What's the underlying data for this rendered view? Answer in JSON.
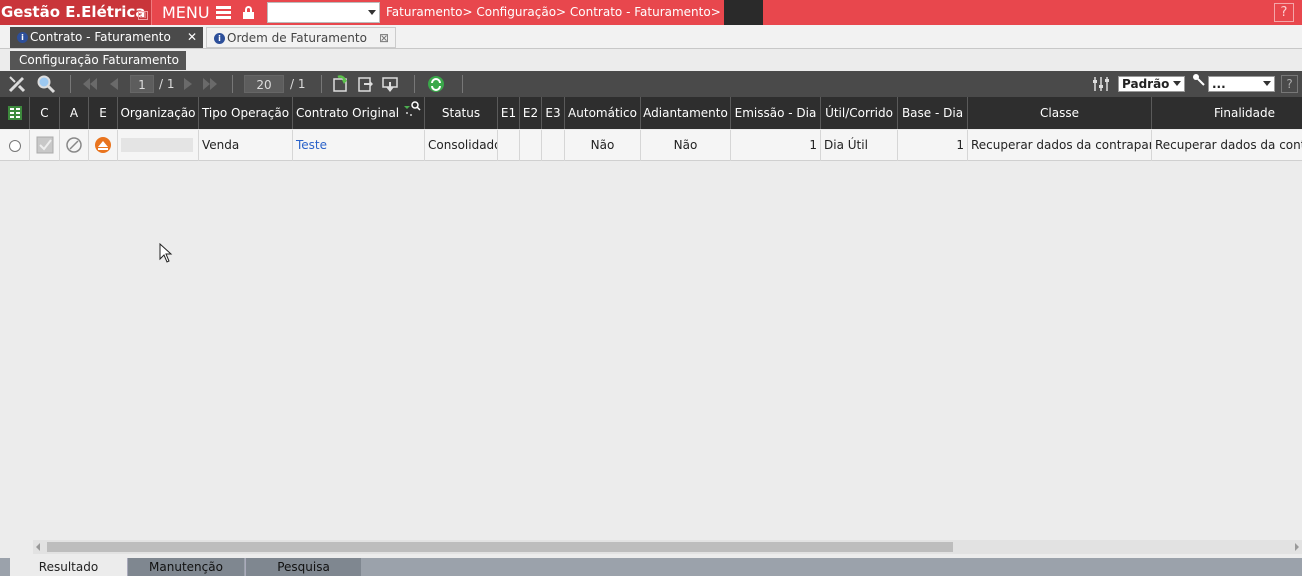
{
  "header": {
    "brand": "Gestão E.Elétrica",
    "brand_badge": "□",
    "menu_label": "MENU",
    "breadcrumb": "Faturamento> Configuração> Contrato - Faturamento>",
    "help": "?"
  },
  "tabs": [
    {
      "label": "Contrato - Faturamento",
      "close": "✕"
    },
    {
      "label": "Ordem de Faturamento",
      "close": "⊠"
    }
  ],
  "subtab": {
    "label": "Configuração Faturamento"
  },
  "toolbar": {
    "page": "1",
    "page_total": "/ 1",
    "page_size": "20",
    "page_size_total": "/ 1",
    "view_select": "Padrão",
    "filter_select": "...",
    "help": "?"
  },
  "grid": {
    "columns": [
      "",
      "C",
      "A",
      "E",
      "Organização",
      "Tipo Operação",
      "Contrato Original",
      "Status",
      "E1",
      "E2",
      "E3",
      "Automático",
      "Adiantamento",
      "Emissão - Dia",
      "Útil/Corrido",
      "Base - Dia",
      "Classe",
      "Finalidade"
    ],
    "rows": [
      {
        "organizacao": "",
        "tipo_operacao": "Venda",
        "contrato_original": "Teste",
        "status": "Consolidado",
        "e1": "",
        "e2": "",
        "e3": "",
        "automatico": "Não",
        "adiantamento": "Não",
        "emissao_dia": "1",
        "util_corrido": "Dia Útil",
        "base_dia": "1",
        "classe": "Recuperar dados da contraparte",
        "finalidade": "Recuperar dados da contraparte"
      }
    ]
  },
  "bottom_tabs": [
    "Resultado",
    "Manutenção",
    "Pesquisa"
  ],
  "colors": {
    "topbar": "#e8474d",
    "brand_bg": "#c9353a",
    "toolbar": "#4a4a4a",
    "grid_header": "#2e2e2e",
    "link": "#2a62c9"
  }
}
